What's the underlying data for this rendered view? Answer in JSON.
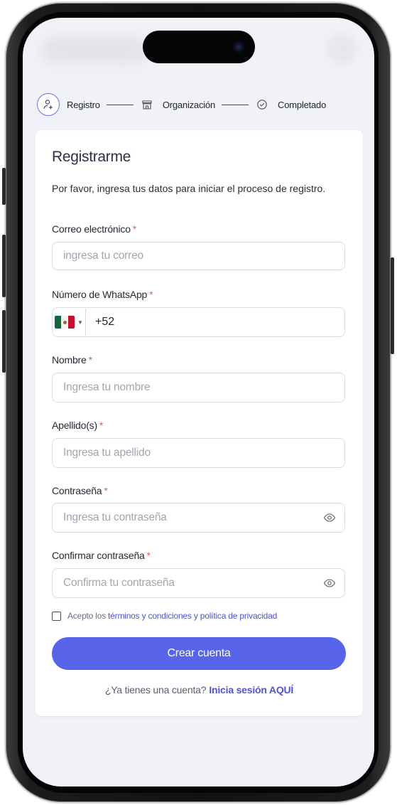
{
  "stepper": {
    "steps": [
      {
        "label": "Registro",
        "icon": "user-plus-icon"
      },
      {
        "label": "Organización",
        "icon": "store-icon"
      },
      {
        "label": "Completado",
        "icon": "check-circle-icon"
      }
    ]
  },
  "form": {
    "title": "Registrarme",
    "description": "Por favor, ingresa tus datos para iniciar el proceso de registro.",
    "required_mark": "*",
    "fields": {
      "email": {
        "label": "Correo electrónico",
        "placeholder": "ingresa tu correo"
      },
      "whatsapp": {
        "label": "Número de WhatsApp",
        "country": "MX",
        "value": "+52"
      },
      "first_name": {
        "label": "Nombre",
        "placeholder": "Ingresa tu nombre"
      },
      "last_name": {
        "label": "Apellido(s)",
        "placeholder": "Ingresa tu apellido"
      },
      "password": {
        "label": "Contraseña",
        "placeholder": "Ingresa tu contraseña"
      },
      "confirm_password": {
        "label": "Confirmar contraseña",
        "placeholder": "Confirma tu contraseña"
      }
    },
    "terms": {
      "prefix": "Acepto los",
      "link": "términos y condiciones y política de privacidad"
    },
    "submit_label": "Crear cuenta",
    "login": {
      "prefix": "¿Ya tienes una cuenta?",
      "link": "Inicia sesión AQUÍ"
    }
  },
  "colors": {
    "accent": "#5865ea",
    "link": "#4e54d6",
    "required": "#e35a5a",
    "screen_bg": "#f1f2f7"
  }
}
